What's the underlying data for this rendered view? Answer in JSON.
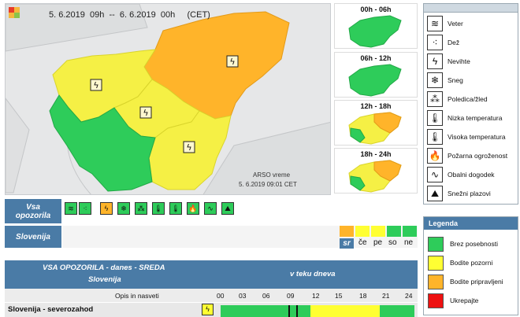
{
  "header": {
    "period": "5. 6.2019  09h  --  6. 6.2019  00h     (CET)"
  },
  "map": {
    "credit_line1": "ARSO vreme",
    "credit_line2": "5. 6.2019  09:01 CET",
    "lightning_glyph": "ϟ"
  },
  "mini_maps": [
    {
      "label": "00h - 06h",
      "state": "green"
    },
    {
      "label": "06h - 12h",
      "state": "green"
    },
    {
      "label": "12h - 18h",
      "state": "mixed"
    },
    {
      "label": "18h - 24h",
      "state": "mixed"
    }
  ],
  "icon_legend": [
    {
      "icon": "wind-icon",
      "glyph": "≋",
      "label": "Veter"
    },
    {
      "icon": "rain-icon",
      "glyph": "⁖",
      "label": "Dež"
    },
    {
      "icon": "thunderstorm-icon",
      "glyph": "ϟ",
      "label": "Nevihte"
    },
    {
      "icon": "snow-icon",
      "glyph": "❄",
      "label": "Sneg"
    },
    {
      "icon": "freezing-rain-icon",
      "glyph": "⁂",
      "label": "Poledica/žled"
    },
    {
      "icon": "low-temperature-icon",
      "glyph": "🌡",
      "label": "Nizka temperatura"
    },
    {
      "icon": "high-temperature-icon",
      "glyph": "🌡",
      "label": "Visoka temperatura"
    },
    {
      "icon": "fire-danger-icon",
      "glyph": "🔥",
      "label": "Požarna ogroženost"
    },
    {
      "icon": "coastal-event-icon",
      "glyph": "∿",
      "label": "Obalni dogodek"
    },
    {
      "icon": "avalanche-icon",
      "glyph": "⛰",
      "label": "Snežni plazovi"
    }
  ],
  "legend": {
    "title": "Legenda",
    "items": [
      {
        "label": "Brez posebnosti",
        "color": "#2ecc5a"
      },
      {
        "label": "Bodite pozorni",
        "color": "#ffff33"
      },
      {
        "label": "Bodite pripravljeni",
        "color": "#ffb42a"
      },
      {
        "label": "Ukrepajte",
        "color": "#ee1111"
      }
    ]
  },
  "warnings_row": {
    "label": "Vsa\nopozorila",
    "icons": [
      {
        "icon": "wind-icon",
        "glyph": "≋",
        "color": "#2ecc5a"
      },
      {
        "icon": "rain-icon",
        "glyph": "⁖",
        "color": "#2ecc5a"
      },
      {
        "icon": "thunderstorm-icon",
        "glyph": "ϟ",
        "color": "#ffb42a"
      },
      {
        "icon": "snow-icon",
        "glyph": "❄",
        "color": "#2ecc5a"
      },
      {
        "icon": "freezing-rain-icon",
        "glyph": "⁂",
        "color": "#2ecc5a"
      },
      {
        "icon": "low-temperature-icon",
        "glyph": "🌡",
        "color": "#2ecc5a"
      },
      {
        "icon": "high-temperature-icon",
        "glyph": "🌡",
        "color": "#2ecc5a"
      },
      {
        "icon": "fire-danger-icon",
        "glyph": "🔥",
        "color": "#2ecc5a"
      },
      {
        "icon": "coastal-event-icon",
        "glyph": "∿",
        "color": "#2ecc5a"
      },
      {
        "icon": "avalanche-icon",
        "glyph": "⛰",
        "color": "#2ecc5a"
      }
    ]
  },
  "slovenija_row": {
    "label": "Slovenija",
    "days": [
      {
        "label": "sr",
        "color": "#ffb42a",
        "highlight": true
      },
      {
        "label": "če",
        "color": "#ffff33",
        "highlight": false
      },
      {
        "label": "pe",
        "color": "#ffff33",
        "highlight": false
      },
      {
        "label": "so",
        "color": "#2ecc5a",
        "highlight": false
      },
      {
        "label": "ne",
        "color": "#2ecc5a",
        "highlight": false
      }
    ]
  },
  "table": {
    "title": "VSA OPOZORILA - danes - SREDA",
    "subtitle": "Slovenija",
    "col_time": "v teku dneva",
    "col_desc": "Opis in nasveti",
    "hours": [
      "00",
      "03",
      "06",
      "09",
      "12",
      "15",
      "18",
      "21",
      "24"
    ],
    "row1": {
      "region": "Slovenija - severozahod"
    }
  }
}
